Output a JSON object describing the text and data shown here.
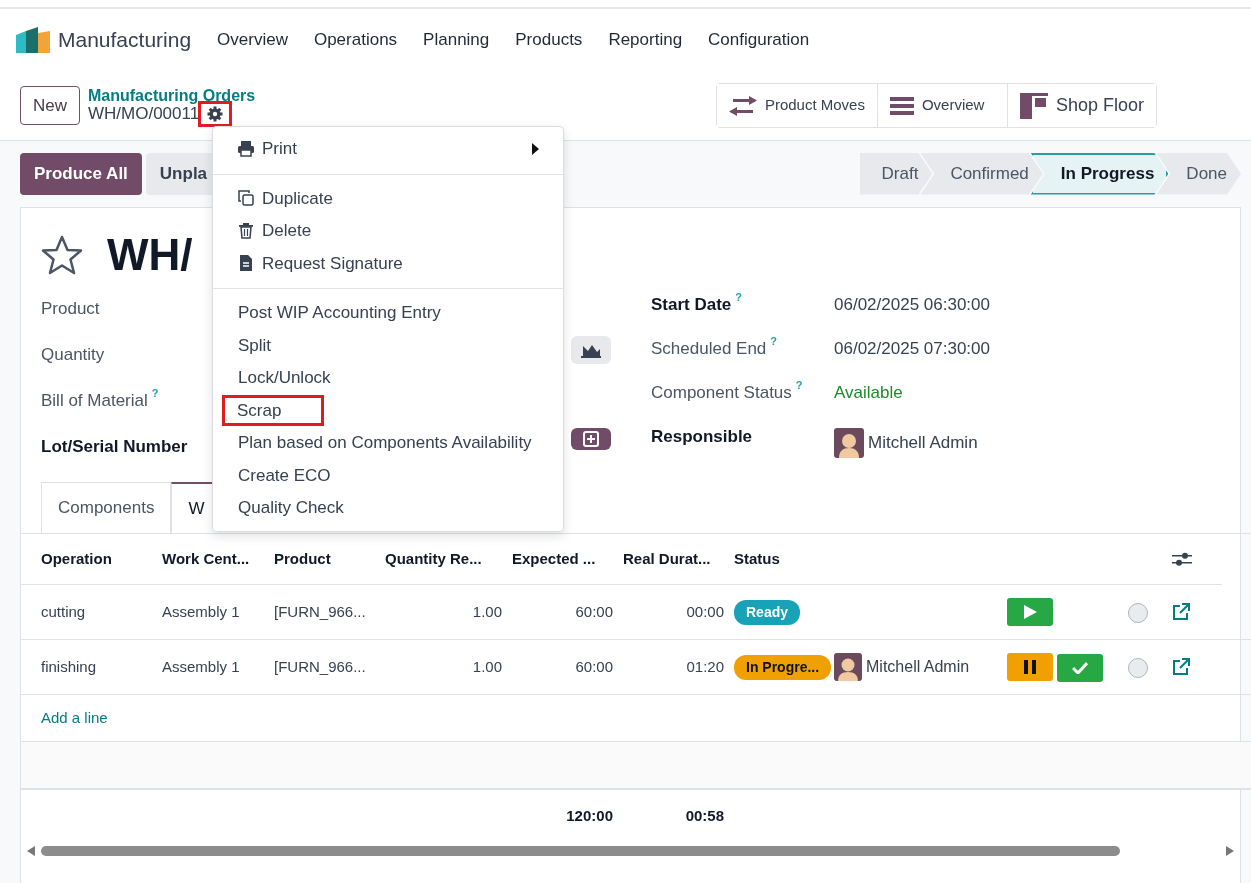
{
  "app": {
    "name": "Manufacturing"
  },
  "menu": [
    "Overview",
    "Operations",
    "Planning",
    "Products",
    "Reporting",
    "Configuration"
  ],
  "control_panel": {
    "new_button": "New",
    "breadcrumb": "Manufacturing Orders",
    "record": "WH/MO/00011",
    "gear_highlighted": true,
    "smart_buttons": [
      {
        "label": "Product Moves",
        "kind": "moves"
      },
      {
        "label": "Overview",
        "kind": "list"
      },
      {
        "label": "Shop Floor",
        "kind": "floor"
      }
    ]
  },
  "actions": [
    {
      "label": "Produce All",
      "kind": "primary"
    },
    {
      "label": "Unpla",
      "kind": "secondary"
    }
  ],
  "stages": [
    {
      "label": "Draft",
      "selected": false
    },
    {
      "label": "Confirmed",
      "selected": false
    },
    {
      "label": "In Progress",
      "selected": true
    },
    {
      "label": "Done",
      "selected": false
    }
  ],
  "title": {
    "starred": false,
    "text": "WH/"
  },
  "left_fields": [
    {
      "label": "Product",
      "bold": false,
      "kind": "none"
    },
    {
      "label": "Quantity",
      "bold": false,
      "kind": "chart"
    },
    {
      "label": "Bill of Material",
      "bold": false,
      "help": "?",
      "kind": "none"
    },
    {
      "label": "Lot/Serial Number",
      "bold": true,
      "kind": "add"
    }
  ],
  "right_fields": [
    {
      "label": "Start Date",
      "bold": true,
      "help": "?",
      "kind": "text",
      "value": "06/02/2025 06:30:00"
    },
    {
      "label": "Scheduled End",
      "bold": false,
      "help": "?",
      "kind": "text",
      "value": "06/02/2025 07:30:00"
    },
    {
      "label": "Component Status",
      "bold": false,
      "help": "?",
      "kind": "status",
      "value": "Available"
    },
    {
      "label": "Responsible",
      "bold": true,
      "kind": "user",
      "value": "Mitchell Admin"
    }
  ],
  "tabs": [
    {
      "label": "Components",
      "selected": false
    },
    {
      "label": "W",
      "selected": true
    }
  ],
  "table": {
    "columns": [
      "Operation",
      "Work Cent...",
      "Product",
      "Quantity Re...",
      "Expected ...",
      "Real Durat...",
      "Status"
    ],
    "rows": [
      {
        "cells": [
          "cutting",
          "Assembly 1",
          "[FURN_966...",
          "1.00",
          "60:00",
          "00:00"
        ],
        "status": "Ready",
        "kind": "ready"
      },
      {
        "cells": [
          "finishing",
          "Assembly 1",
          "[FURN_966...",
          "1.00",
          "60:00",
          "01:20"
        ],
        "status": "In Progre...",
        "kind": "progress",
        "user": "Mitchell Admin"
      }
    ],
    "add_line": "Add a line",
    "totals": [
      "120:00",
      "00:58"
    ]
  },
  "gear_menu": {
    "groups": [
      [
        {
          "label": "Print",
          "kind": "print",
          "highlighted": false
        }
      ],
      [
        {
          "label": "Duplicate",
          "kind": "copy",
          "highlighted": false
        },
        {
          "label": "Delete",
          "kind": "trash",
          "highlighted": false
        },
        {
          "label": "Request Signature",
          "kind": "document",
          "highlighted": false
        }
      ],
      [
        {
          "label": "Post WIP Accounting Entry",
          "kind": "plain",
          "highlighted": false
        },
        {
          "label": "Split",
          "kind": "plain",
          "highlighted": false
        },
        {
          "label": "Lock/Unlock",
          "kind": "plain",
          "highlighted": false
        },
        {
          "label": "Scrap",
          "kind": "plain",
          "highlighted": true
        },
        {
          "label": "Plan based on Components Availability",
          "kind": "plain",
          "highlighted": false
        },
        {
          "label": "Create ECO",
          "kind": "plain",
          "highlighted": false
        },
        {
          "label": "Quality Check",
          "kind": "plain",
          "highlighted": false
        }
      ]
    ]
  }
}
